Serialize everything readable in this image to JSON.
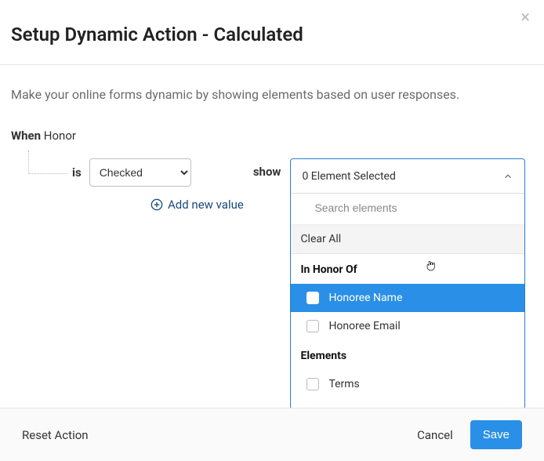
{
  "header": {
    "title": "Setup Dynamic Action - Calculated"
  },
  "intro": "Make your online forms dynamic by showing elements based on user responses.",
  "when": {
    "label": "When",
    "field": "Honor"
  },
  "rule": {
    "is_label": "is",
    "condition_options": [
      "Checked"
    ],
    "condition_value": "Checked",
    "show_label": "show",
    "add_new_label": "Add new value"
  },
  "elements_dropdown": {
    "summary": "0 Element Selected",
    "search_placeholder": "Search elements",
    "clear_all": "Clear All",
    "groups": [
      {
        "title": "In Honor Of",
        "options": [
          "Honoree Name",
          "Honoree Email"
        ]
      },
      {
        "title": "Elements",
        "options": [
          "Terms"
        ]
      }
    ]
  },
  "footer": {
    "reset": "Reset Action",
    "cancel": "Cancel",
    "save": "Save"
  }
}
